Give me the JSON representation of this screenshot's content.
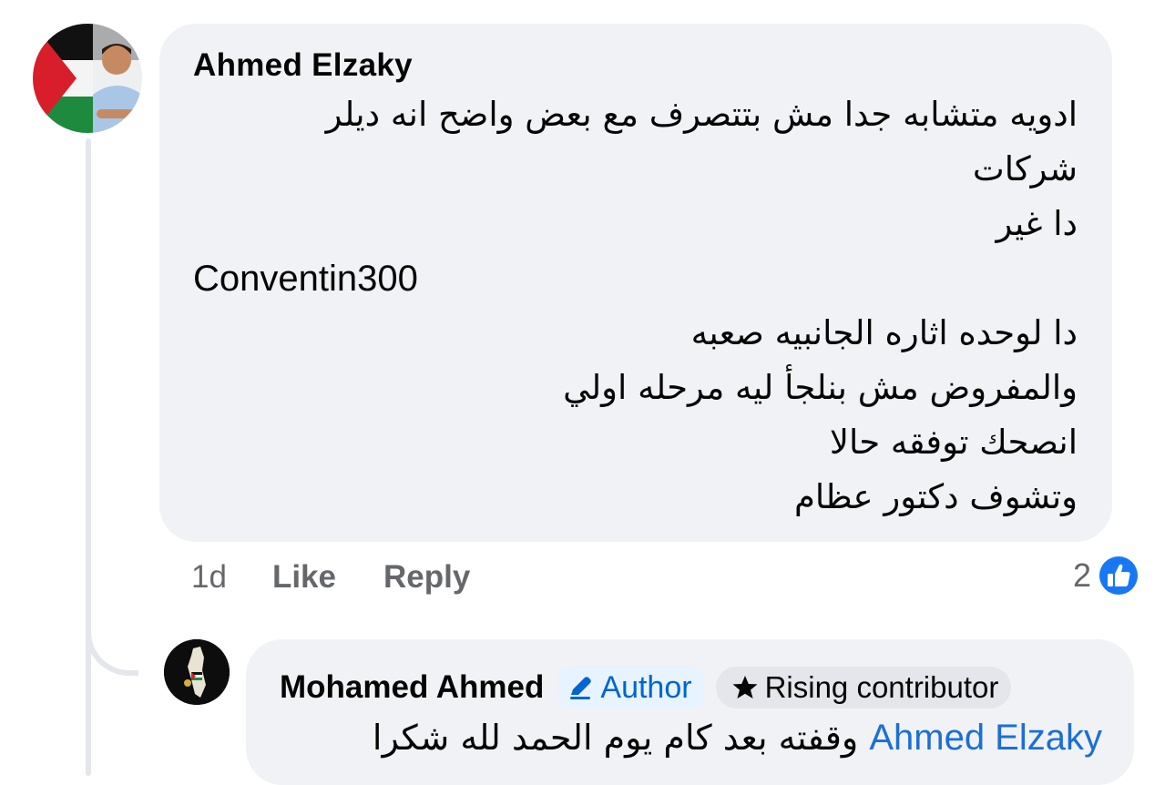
{
  "comment": {
    "author": "Ahmed Elzaky",
    "lines": [
      "ادويه متشابه جدا   مش بتتصرف مع بعض واضح انه ديلر",
      "شركات",
      "دا غير",
      "Conventin300",
      "دا لوحده اثاره الجانبيه صعبه",
      " والمفروض مش بنلجأ ليه مرحله اولي",
      "انصحك توفقه حالا",
      "وتشوف دكتور عظام"
    ],
    "time": "1d",
    "like_label": "Like",
    "reply_label": "Reply",
    "reaction_count": "2",
    "reaction_icon": "like-reaction-icon"
  },
  "reply": {
    "author": "Mohamed Ahmed",
    "author_badge": "Author",
    "author_badge_icon": "pencil-icon",
    "contributor_badge": "Rising contributor",
    "contributor_badge_icon": "star-icon",
    "mention": "Ahmed Elzaky",
    "text": "وقفته بعد كام يوم الحمد لله شكرا"
  },
  "colors": {
    "bubble": "#f0f2f5",
    "link": "#1b6fd6",
    "like_blue": "#1877f2",
    "muted": "#65676b"
  }
}
